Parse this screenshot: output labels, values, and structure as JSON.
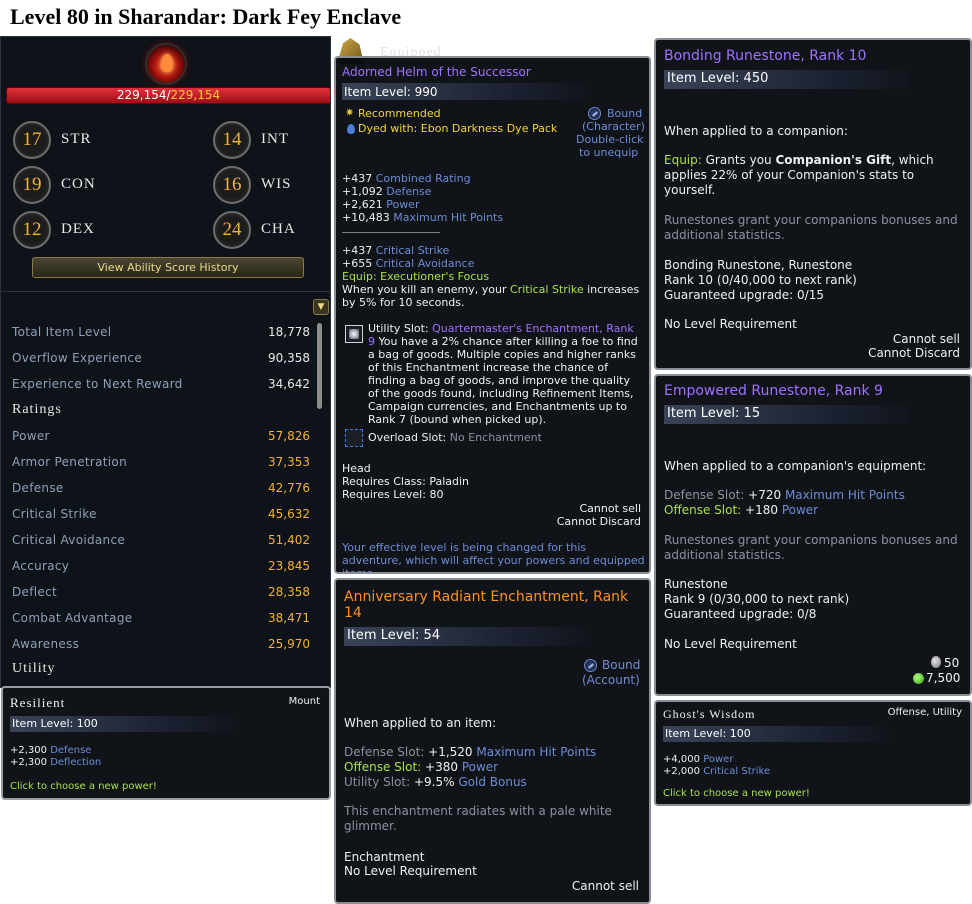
{
  "page": {
    "title": "Level 80 in Sharandar: Dark Fey Enclave"
  },
  "colors": {
    "hp_bar": "#e3303c",
    "rating_value": "#f2b233",
    "stat_label": "#8ea0b8",
    "stat_blue": "#6c8cd6",
    "equip_green": "#a8e04a",
    "item_purple": "#a070ff",
    "item_orange": "#ff8f1e",
    "recommended_yellow": "#f5d43a"
  },
  "character": {
    "hp_current": "229,154",
    "hp_separator": "/",
    "hp_max": "229,154",
    "abilities": [
      {
        "value": "17",
        "abbr": "STR"
      },
      {
        "value": "14",
        "abbr": "INT"
      },
      {
        "value": "19",
        "abbr": "CON"
      },
      {
        "value": "16",
        "abbr": "WIS"
      },
      {
        "value": "12",
        "abbr": "DEX"
      },
      {
        "value": "24",
        "abbr": "CHA"
      }
    ],
    "history_button": "View Ability Score History",
    "general_stats": [
      {
        "label": "Total Item Level",
        "value": "18,778"
      },
      {
        "label": "Overflow Experience",
        "value": "90,358"
      },
      {
        "label": "Experience to Next Reward",
        "value": "34,642"
      }
    ],
    "ratings_heading": "Ratings",
    "ratings": [
      {
        "label": "Power",
        "value": "57,826"
      },
      {
        "label": "Armor Penetration",
        "value": "37,353"
      },
      {
        "label": "Defense",
        "value": "42,776"
      },
      {
        "label": "Critical Strike",
        "value": "45,632"
      },
      {
        "label": "Critical Avoidance",
        "value": "51,402"
      },
      {
        "label": "Accuracy",
        "value": "23,845"
      },
      {
        "label": "Deflect",
        "value": "28,358"
      },
      {
        "label": "Combat Advantage",
        "value": "38,471"
      },
      {
        "label": "Awareness",
        "value": "25,970"
      }
    ],
    "utility_heading": "Utility"
  },
  "resilient": {
    "name": "Resilient",
    "type": "Mount",
    "item_level": "Item Level: 100",
    "stat1_value": "+2,300",
    "stat1_name": "Defense",
    "stat2_value": "+2,300",
    "stat2_name": "Deflection",
    "footer": "Click to choose a new power!"
  },
  "helm": {
    "banner": "Equipped",
    "name": "Adorned Helm of the Successor",
    "item_level": "Item Level: 990",
    "recommended": "Recommended",
    "dyed_label": "Dyed with:",
    "dye_name": "Ebon Darkness Dye Pack",
    "bound": "Bound",
    "bound_type": "(Character)",
    "double_click": "Double-click",
    "to_unequip": "to unequip",
    "stats": [
      {
        "value": "+437",
        "name": "Combined Rating"
      },
      {
        "value": "+1,092",
        "name": "Defense"
      },
      {
        "value": "+2,621",
        "name": "Power"
      },
      {
        "value": "+10,483",
        "name": "Maximum Hit Points"
      }
    ],
    "stats2": [
      {
        "value": "+437",
        "name": "Critical Strike"
      },
      {
        "value": "+655",
        "name": "Critical Avoidance"
      }
    ],
    "equip_label": "Equip:",
    "equip_name": "Executioner's Focus",
    "equip_desc_a": "When you kill an enemy, your ",
    "equip_desc_hl": "Critical Strike",
    "equip_desc_b": " increases by 5% for 10 seconds.",
    "utility_label": "Utility Slot:",
    "utility_name": "Quartermaster's Enchantment, Rank 9",
    "utility_desc": "You have a 2% chance after killing a foe to find a bag of goods. Multiple copies and higher ranks of this Enchantment increase the chance of finding a bag of goods, and improve the quality of the goods found, including Refinement Items, Campaign currencies, and Enchantments up to Rank 7 (bound when picked up).",
    "overload_label": "Overload Slot:",
    "overload_value": "No Enchantment",
    "slot": "Head",
    "requires_class": "Requires Class: Paladin",
    "requires_level": "Requires Level: 80",
    "cannot_sell": "Cannot sell",
    "cannot_discard": "Cannot Discard",
    "effective_note": "Your effective level is being changed for this adventure, which will affect your powers and equipped items."
  },
  "enchant": {
    "name": "Anniversary Radiant Enchantment, Rank 14",
    "item_level": "Item Level: 54",
    "bound": "Bound",
    "bound_type": "(Account)",
    "applied": "When applied to an item:",
    "defense_label": "Defense Slot:",
    "defense_value": "+1,520",
    "defense_name": "Maximum Hit Points",
    "offense_label": "Offense Slot:",
    "offense_value": "+380",
    "offense_name": "Power",
    "utility_label": "Utility Slot:",
    "utility_value": "+9.5%",
    "utility_name": "Gold Bonus",
    "flavor": "This enchantment radiates with a pale white glimmer.",
    "type": "Enchantment",
    "level_req": "No Level Requirement",
    "cannot_sell": "Cannot sell"
  },
  "bonding": {
    "name": "Bonding Runestone, Rank 10",
    "item_level": "Item Level: 450",
    "applied": "When applied to a companion:",
    "equip_label": "Equip:",
    "equip_a": " Grants you ",
    "equip_bold": "Companion's Gift",
    "equip_b": ", which applies 22% of your Companion's stats to yourself.",
    "flavor": "Runestones grant your companions bonuses and additional statistics.",
    "type": "Bonding Runestone, Runestone",
    "rank": "Rank 10 (0/40,000 to next rank)",
    "guaranteed": "Guaranteed upgrade: 0/15",
    "level_req": "No Level Requirement",
    "cannot_sell": "Cannot sell",
    "cannot_discard": "Cannot Discard"
  },
  "empowered": {
    "name": "Empowered Runestone, Rank 9",
    "item_level": "Item Level: 15",
    "applied": "When applied to a companion's equipment:",
    "defense_label": "Defense Slot:",
    "defense_value": "+720",
    "defense_name": "Maximum Hit Points",
    "offense_label": "Offense Slot:",
    "offense_value": "+180",
    "offense_name": "Power",
    "flavor": "Runestones grant your companions bonuses and additional statistics.",
    "type": "Runestone",
    "rank": "Rank 9 (0/30,000 to next rank)",
    "guaranteed": "Guaranteed upgrade: 0/8",
    "level_req": "No Level Requirement",
    "price_silver": "50",
    "price_ad": "7,500"
  },
  "ghost": {
    "name": "Ghost's Wisdom",
    "type": "Offense, Utility",
    "item_level": "Item Level: 100",
    "stat1_value": "+4,000",
    "stat1_name": "Power",
    "stat2_value": "+2,000",
    "stat2_name": "Critical Strike",
    "footer": "Click to choose a new power!"
  },
  "icons": {
    "hp": "blood-drop-icon",
    "bound": "shield-bind-icon",
    "recommended": "star-icon",
    "dye": "dye-drop-icon",
    "utility_slot": "enchant-slot-icon",
    "overload_slot": "empty-slot-icon",
    "silver": "silver-coin-icon",
    "ad": "astral-diamond-icon",
    "helm": "helm-icon"
  }
}
